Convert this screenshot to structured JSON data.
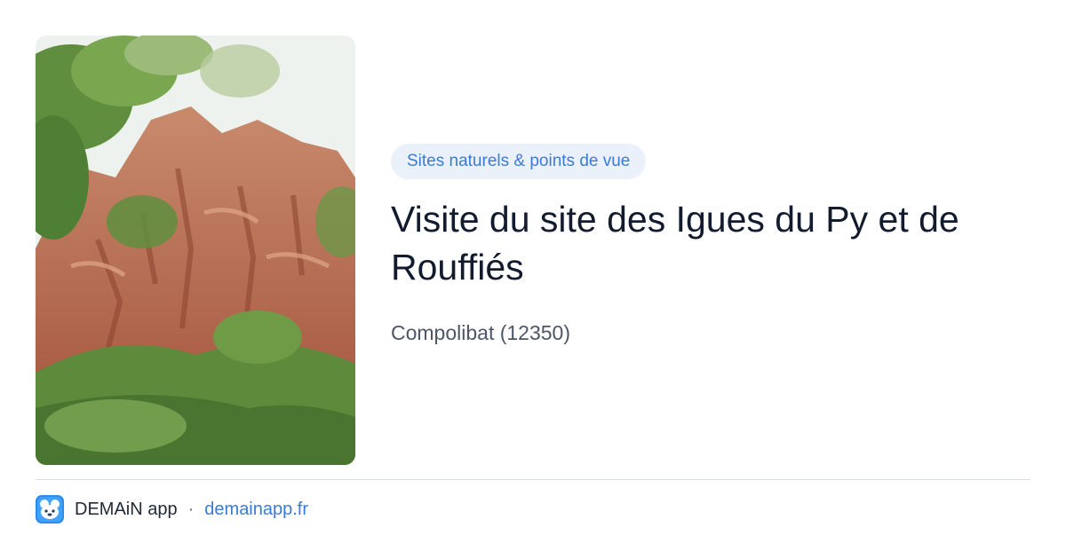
{
  "preview": {
    "category": "Sites naturels & points de vue",
    "title": "Visite du site des Igues du Py et de Rouffiés",
    "location": "Compolibat (12350)",
    "image_alt": "Visite du site des Igues du Py et de Rouffiés"
  },
  "footer": {
    "app_name": "DEMAiN app",
    "separator": "·",
    "domain": "demainapp.fr"
  },
  "colors": {
    "accent": "#3a7bd5",
    "category_bg": "#eaf1fb",
    "title": "#131c2e",
    "muted": "#4d5666",
    "divider": "#dde2e8"
  },
  "icons": [
    "app-logo-icon"
  ]
}
